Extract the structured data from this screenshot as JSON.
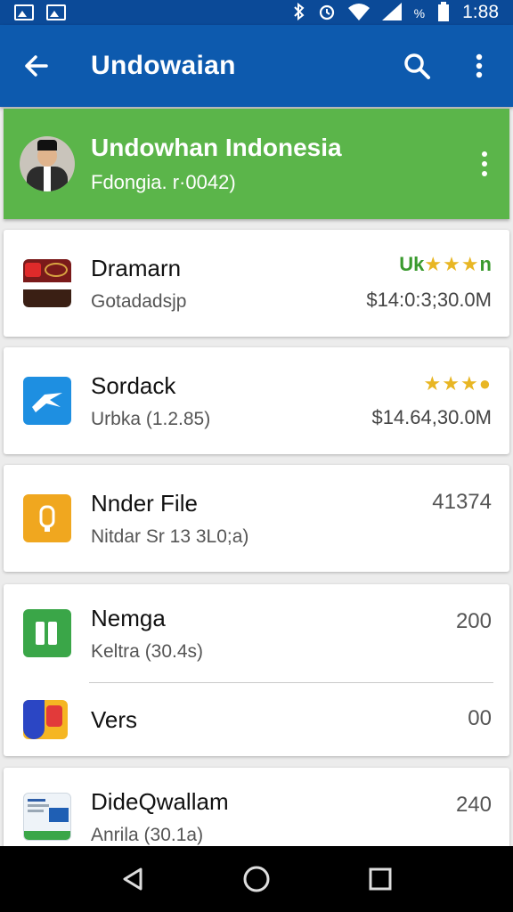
{
  "status_bar": {
    "time": "1:88",
    "battery": "%"
  },
  "app_bar": {
    "title": "Undowaian"
  },
  "profile": {
    "name": "Undowhan Indonesia",
    "subtitle": "Fdongia. r·0042)"
  },
  "items": [
    {
      "title": "Dramarn",
      "subtitle": "Gotadadsjp",
      "price": "$14:0:3;30.0M",
      "badge": "Uk",
      "stars": "★★★",
      "stars_end": "n"
    },
    {
      "title": "Sordack",
      "subtitle": "Urbka (1.2.85)",
      "price": "$14.64,30.0M",
      "stars": "★★★●"
    },
    {
      "title": "Nnder File",
      "subtitle": "Nitdar Sr 13 3L0;a)",
      "value": "41374"
    },
    {
      "title": "Nemga",
      "subtitle": "Keltra (30.4s)",
      "value": "200"
    },
    {
      "title": "Vers",
      "value": "00"
    },
    {
      "title": "DideQwallam",
      "subtitle": "Anrila (30.1a)",
      "value": "240"
    }
  ],
  "colors": {
    "status_bar": "#0b4a98",
    "app_bar": "#0d5aae",
    "profile_bg": "#5bb54a",
    "star": "#e8b624",
    "nav_bar": "#000000"
  },
  "icons": [
    "image-icon",
    "bluetooth-icon",
    "alarm-icon",
    "wifi-icon",
    "signal-icon",
    "battery-icon",
    "back-arrow-icon",
    "search-icon",
    "more-vert-icon",
    "nav-back-icon",
    "nav-home-icon",
    "nav-recents-icon"
  ]
}
